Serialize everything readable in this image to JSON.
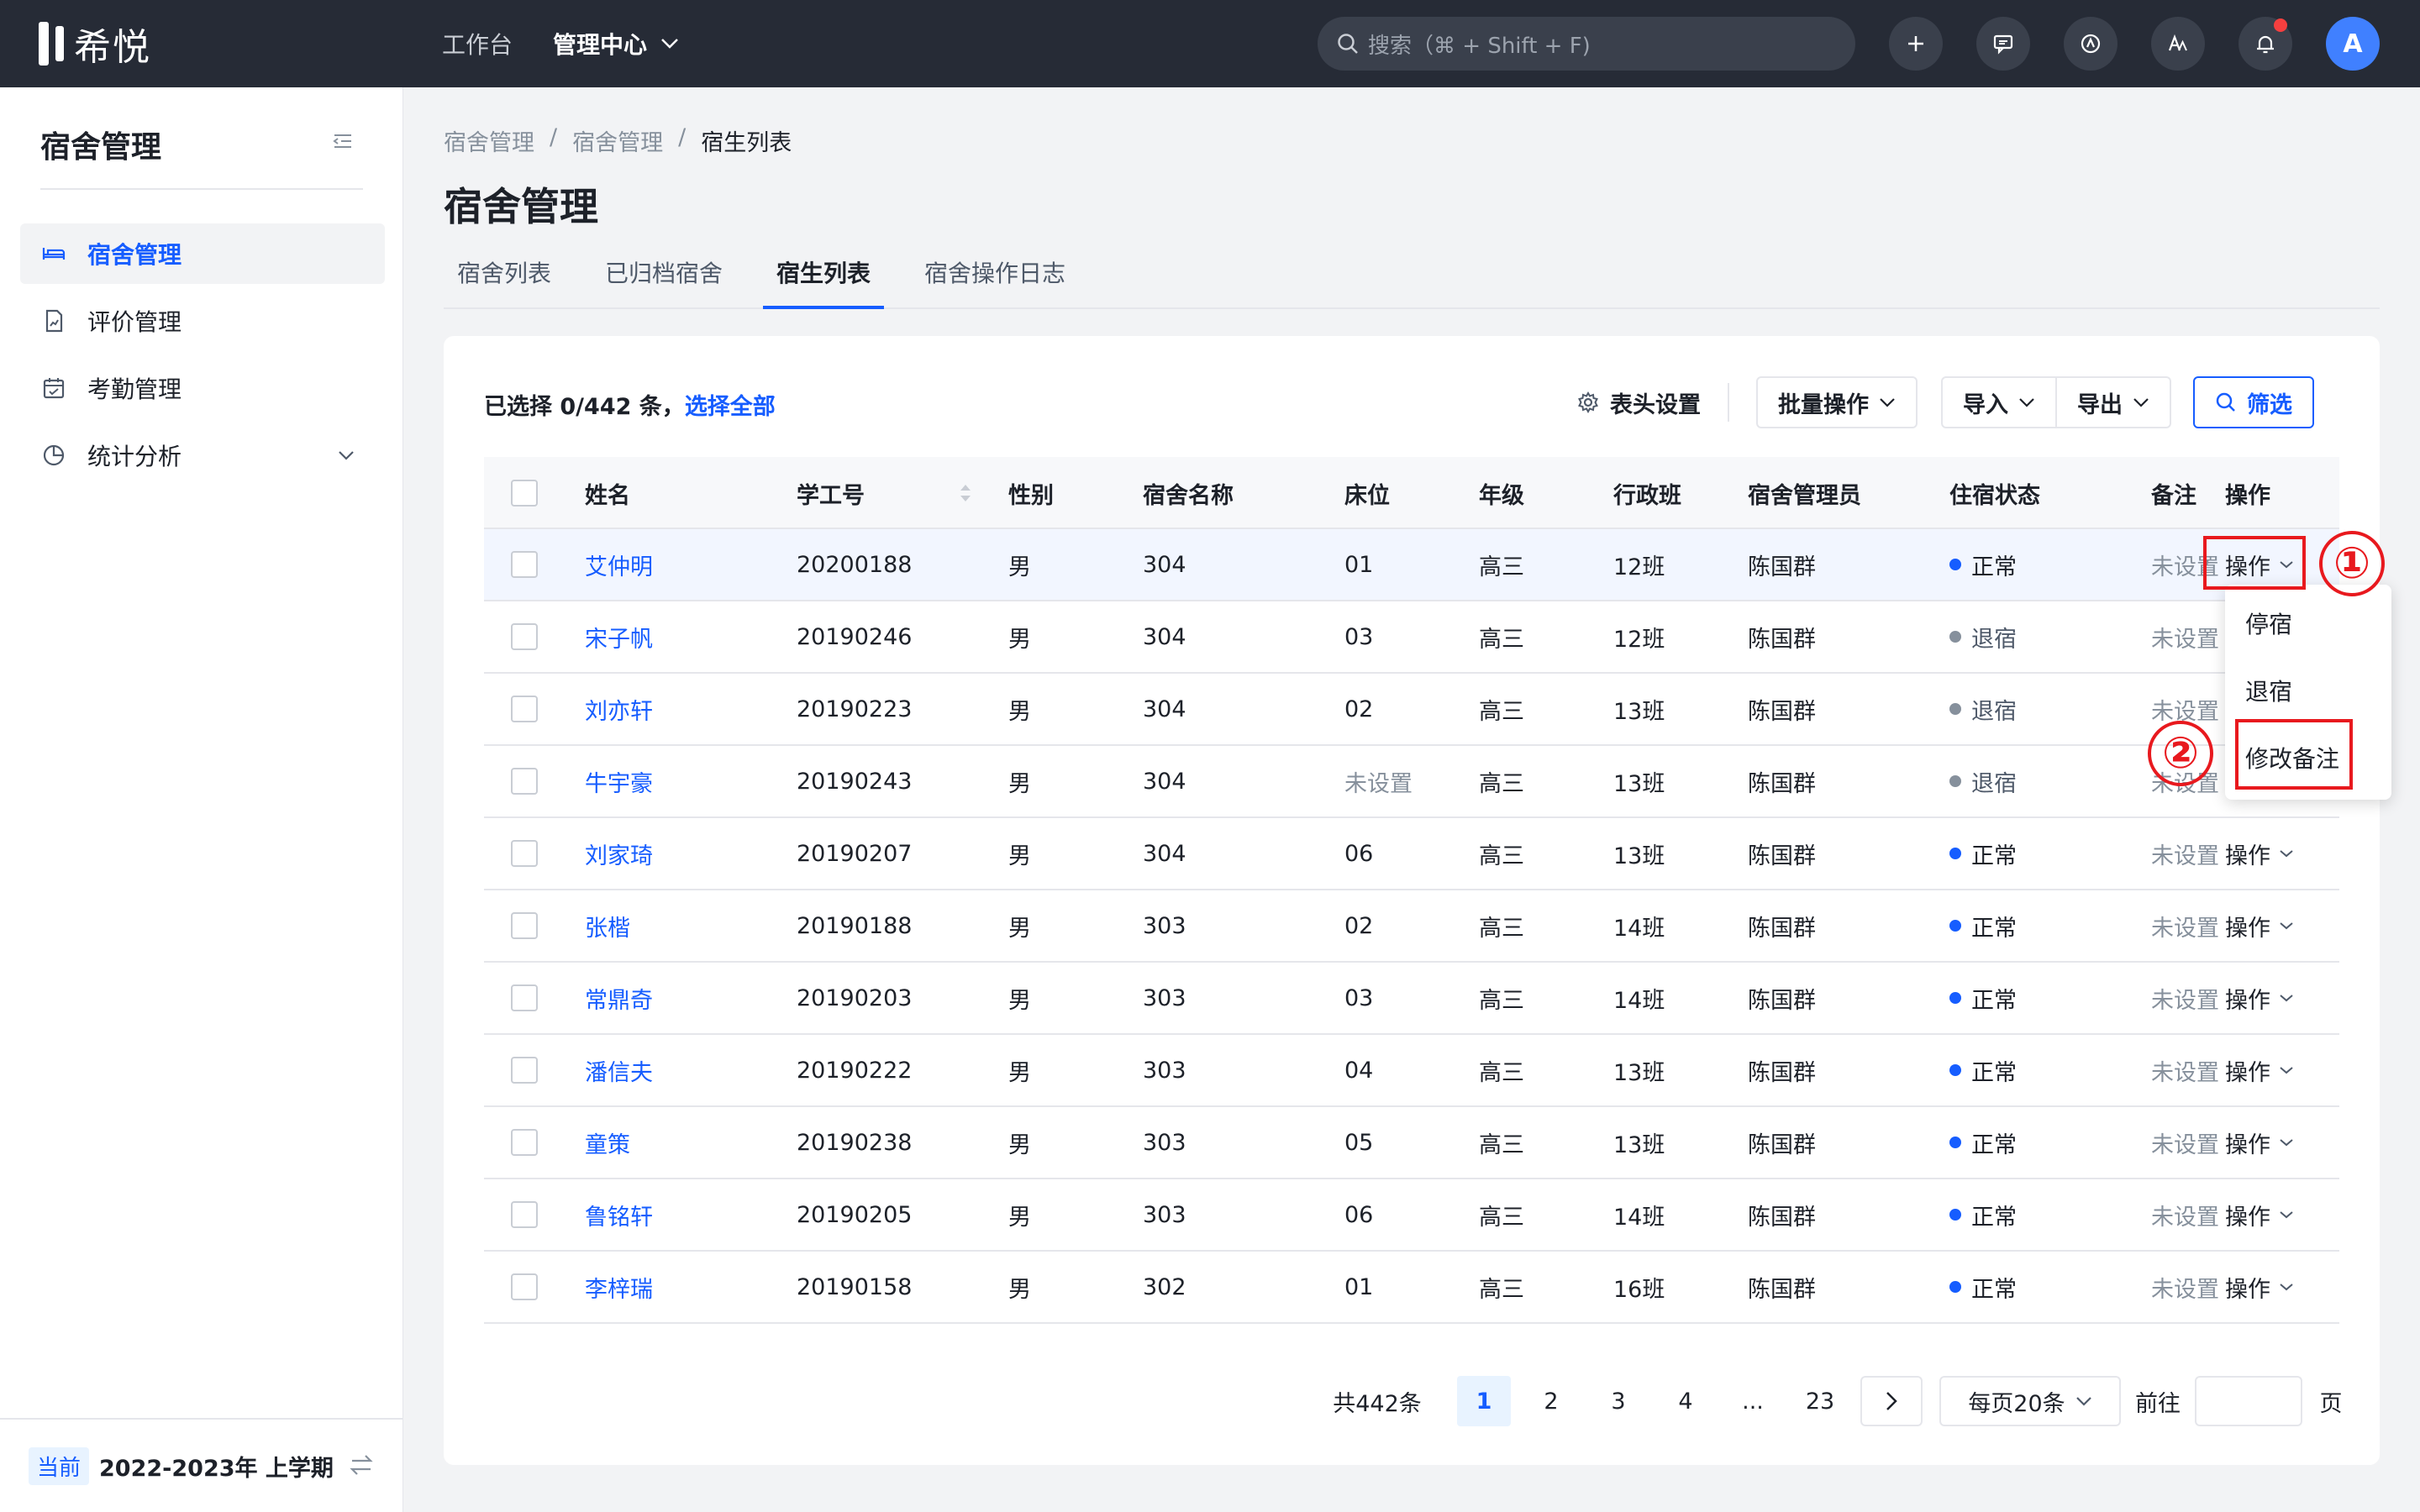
{
  "app": {
    "name": "希悦"
  },
  "topnav": {
    "workbench": "工作台",
    "admin_center": "管理中心"
  },
  "search": {
    "placeholder": "搜索（⌘ + Shift + F)"
  },
  "user": {
    "avatar_letter": "A"
  },
  "sidebar": {
    "title": "宿舍管理",
    "items": [
      {
        "label": "宿舍管理",
        "icon": "bed-icon",
        "active": true
      },
      {
        "label": "评价管理",
        "icon": "evaluation-icon"
      },
      {
        "label": "考勤管理",
        "icon": "calendar-icon"
      },
      {
        "label": "统计分析",
        "icon": "pie-chart-icon",
        "expandable": true
      }
    ],
    "term_badge": "当前",
    "term": "2022-2023年 上学期"
  },
  "breadcrumb": [
    "宿舍管理",
    "宿舍管理",
    "宿生列表"
  ],
  "page_title": "宿舍管理",
  "tabs": [
    "宿舍列表",
    "已归档宿舍",
    "宿生列表",
    "宿舍操作日志"
  ],
  "active_tab": "宿生列表",
  "selection": {
    "prefix": "已选择 0/442 条，",
    "select_all": "选择全部"
  },
  "toolbar": {
    "header_settings": "表头设置",
    "batch": "批量操作",
    "import": "导入",
    "export": "导出",
    "filter": "筛选"
  },
  "columns": [
    "姓名",
    "学工号",
    "性别",
    "宿舍名称",
    "床位",
    "年级",
    "行政班",
    "宿舍管理员",
    "住宿状态",
    "备注",
    "操作"
  ],
  "rows": [
    {
      "name": "艾仲明",
      "id": "20200188",
      "gender": "男",
      "dorm": "304",
      "bed": "01",
      "grade": "高三",
      "cls": "12班",
      "admin": "陈国群",
      "status": "正常",
      "remark": "未设置",
      "op": "操作"
    },
    {
      "name": "宋子帆",
      "id": "20190246",
      "gender": "男",
      "dorm": "304",
      "bed": "03",
      "grade": "高三",
      "cls": "12班",
      "admin": "陈国群",
      "status": "退宿",
      "remark": "未设置",
      "op": "操作"
    },
    {
      "name": "刘亦轩",
      "id": "20190223",
      "gender": "男",
      "dorm": "304",
      "bed": "02",
      "grade": "高三",
      "cls": "13班",
      "admin": "陈国群",
      "status": "退宿",
      "remark": "未设置",
      "op": "操作"
    },
    {
      "name": "牛宇豪",
      "id": "20190243",
      "gender": "男",
      "dorm": "304",
      "bed": "未设置",
      "grade": "高三",
      "cls": "13班",
      "admin": "陈国群",
      "status": "退宿",
      "remark": "未设置",
      "op": "操作"
    },
    {
      "name": "刘家琦",
      "id": "20190207",
      "gender": "男",
      "dorm": "304",
      "bed": "06",
      "grade": "高三",
      "cls": "13班",
      "admin": "陈国群",
      "status": "正常",
      "remark": "未设置",
      "op": "操作"
    },
    {
      "name": "张楷",
      "id": "20190188",
      "gender": "男",
      "dorm": "303",
      "bed": "02",
      "grade": "高三",
      "cls": "14班",
      "admin": "陈国群",
      "status": "正常",
      "remark": "未设置",
      "op": "操作"
    },
    {
      "name": "常鼎奇",
      "id": "20190203",
      "gender": "男",
      "dorm": "303",
      "bed": "03",
      "grade": "高三",
      "cls": "14班",
      "admin": "陈国群",
      "status": "正常",
      "remark": "未设置",
      "op": "操作"
    },
    {
      "name": "潘信夫",
      "id": "20190222",
      "gender": "男",
      "dorm": "303",
      "bed": "04",
      "grade": "高三",
      "cls": "13班",
      "admin": "陈国群",
      "status": "正常",
      "remark": "未设置",
      "op": "操作"
    },
    {
      "name": "童策",
      "id": "20190238",
      "gender": "男",
      "dorm": "303",
      "bed": "05",
      "grade": "高三",
      "cls": "13班",
      "admin": "陈国群",
      "status": "正常",
      "remark": "未设置",
      "op": "操作"
    },
    {
      "name": "鲁铭轩",
      "id": "20190205",
      "gender": "男",
      "dorm": "303",
      "bed": "06",
      "grade": "高三",
      "cls": "14班",
      "admin": "陈国群",
      "status": "正常",
      "remark": "未设置",
      "op": "操作"
    },
    {
      "name": "李梓瑞",
      "id": "20190158",
      "gender": "男",
      "dorm": "302",
      "bed": "01",
      "grade": "高三",
      "cls": "16班",
      "admin": "陈国群",
      "status": "正常",
      "remark": "未设置",
      "op": "操作"
    }
  ],
  "status_colors": {
    "正常": "#165dff",
    "退宿": "#86909c"
  },
  "dropdown": [
    "停宿",
    "退宿",
    "修改备注"
  ],
  "annotations": [
    "①",
    "②"
  ],
  "pagination": {
    "total": "共442条",
    "pages": [
      "1",
      "2",
      "3",
      "4",
      "...",
      "23"
    ],
    "current": "1",
    "page_size": "每页20条",
    "goto_label": "前往",
    "page_suffix": "页"
  },
  "colors": {
    "accent": "#165dff",
    "topbar": "#262b36",
    "annotation": "#e8191e"
  }
}
